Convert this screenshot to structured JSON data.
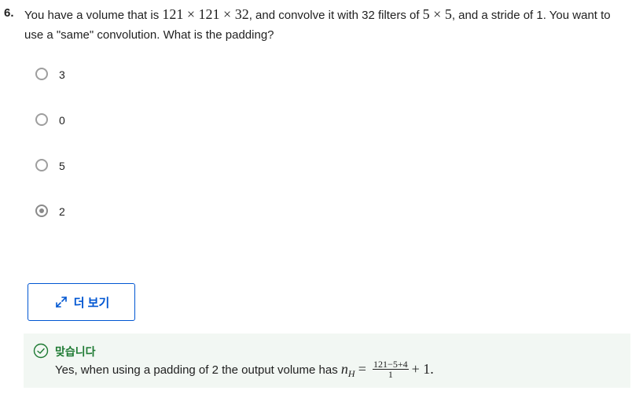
{
  "question": {
    "number": "6.",
    "text_1": "You have a volume that is ",
    "math_1": "121 × 121 × 32",
    "text_2": ", and convolve it with 32 filters of ",
    "math_2": "5 × 5",
    "text_3": ", and a stride of 1. You want to use a \"same\" convolution. What is the padding?"
  },
  "options": [
    {
      "label": "3",
      "selected": false
    },
    {
      "label": "0",
      "selected": false
    },
    {
      "label": "5",
      "selected": false
    },
    {
      "label": "2",
      "selected": true
    }
  ],
  "more_button": {
    "label": "더 보기",
    "icon": "expand-arrows-icon"
  },
  "feedback": {
    "status": "맞습니다",
    "status_color": "#1e7a33",
    "text": "Yes, when using a padding of 2 the output volume has ",
    "formula_var": "n",
    "formula_sub": "H",
    "formula_eq": "=",
    "formula_num": "121−5+4",
    "formula_den": "1",
    "formula_tail": "+ 1."
  },
  "colors": {
    "accent": "#0056d2",
    "feedback_bg": "#f2f7f3"
  }
}
